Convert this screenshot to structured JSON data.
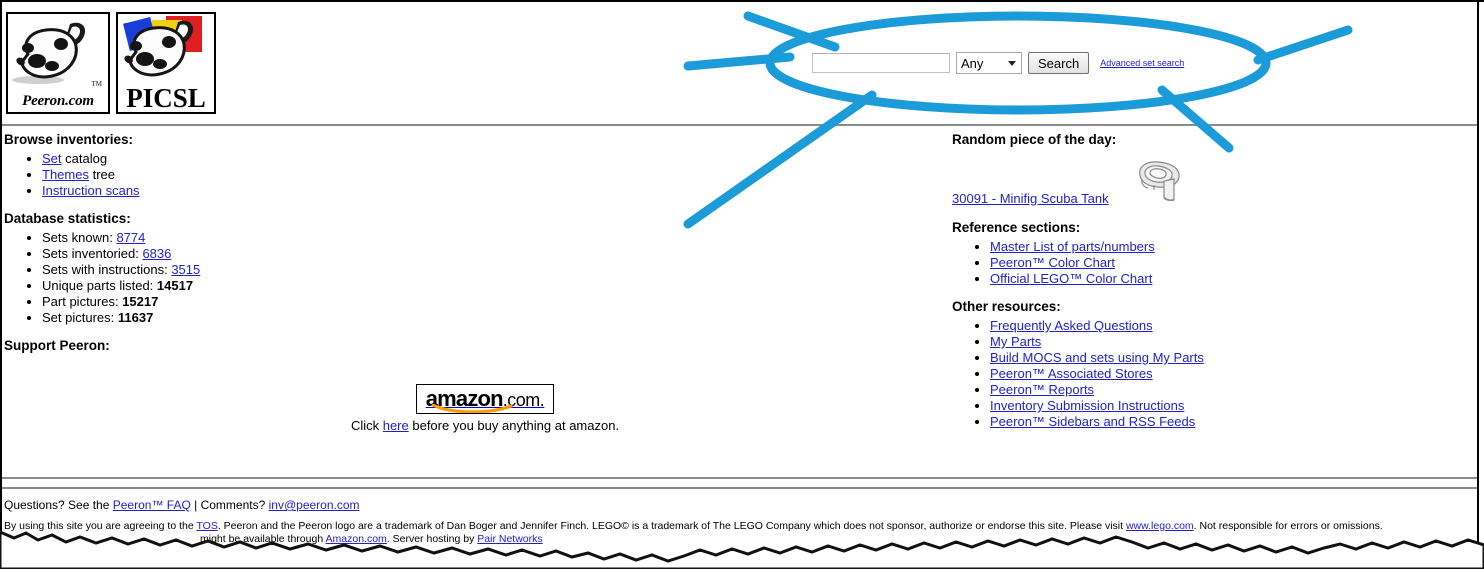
{
  "site": {
    "logo_primary_caption": "Peeron.com",
    "logo_primary_tm": "TM",
    "logo_secondary_caption": "PICSL"
  },
  "search": {
    "input_value": "",
    "input_placeholder": "",
    "select_value": "Any",
    "select_options": [
      "Any"
    ],
    "button_label": "Search",
    "advanced_link": "Advanced set search"
  },
  "browse": {
    "heading": "Browse inventories:",
    "items": [
      {
        "link": "Set",
        "suffix": " catalog"
      },
      {
        "link": "Themes",
        "suffix": " tree"
      },
      {
        "link": "Instruction scans",
        "suffix": ""
      }
    ]
  },
  "stats": {
    "heading": "Database statistics:",
    "items": [
      {
        "label": "Sets known: ",
        "value": "8774",
        "is_link": true
      },
      {
        "label": "Sets inventoried: ",
        "value": "6836",
        "is_link": true
      },
      {
        "label": "Sets with instructions: ",
        "value": "3515",
        "is_link": true
      },
      {
        "label": "Unique parts listed: ",
        "value": "14517",
        "is_link": false
      },
      {
        "label": "Part pictures: ",
        "value": "15217",
        "is_link": false
      },
      {
        "label": "Set pictures: ",
        "value": "11637",
        "is_link": false
      }
    ]
  },
  "support": {
    "heading": "Support Peeron:",
    "amazon_word": "amazon",
    "amazon_dotcom": ".com.",
    "caption_before": "Click ",
    "caption_link": "here",
    "caption_after": " before you buy anything at amazon."
  },
  "random_piece": {
    "heading": "Random piece of the day:",
    "link": "30091 - Minifig Scuba Tank",
    "image_name": "minifig-scuba-tank-part-image"
  },
  "reference": {
    "heading": "Reference sections:",
    "items": [
      "Master List of parts/numbers",
      "Peeron™ Color Chart",
      "Official LEGO™ Color Chart"
    ]
  },
  "other_resources": {
    "heading": "Other resources:",
    "items": [
      "Frequently Asked Questions",
      "My Parts",
      "Build MOCS and sets using My Parts",
      "Peeron™ Associated Stores",
      "Peeron™ Reports",
      "Inventory Submission Instructions",
      "Peeron™ Sidebars and RSS Feeds"
    ]
  },
  "footer": {
    "questions_text": "Questions? See the ",
    "faq_link": "Peeron™ FAQ",
    "separator": " | ",
    "comments_text": "Comments? ",
    "email_link": "inv@peeron.com",
    "legal_a": "By using this site you are agreeing to the ",
    "tos_link": "TOS",
    "legal_b": ". Peeron and the Peeron logo are a trademark of Dan Boger and Jennifer Finch. LEGO© is a trademark of The LEGO Company which does not sponsor, authorize or endorse this site.  Please visit ",
    "lego_link": "www.lego.com",
    "legal_c": ".   Not responsible for errors or omissions.",
    "legal_d": "might be available through ",
    "amazon_link": "Amazon.com",
    "legal_e": ". Server hosting by ",
    "pair_link": "Pair Networks"
  },
  "annotation": {
    "color": "#1B9BD8",
    "shape": "ellipse-with-radiating-lines",
    "target": "search-cluster"
  }
}
